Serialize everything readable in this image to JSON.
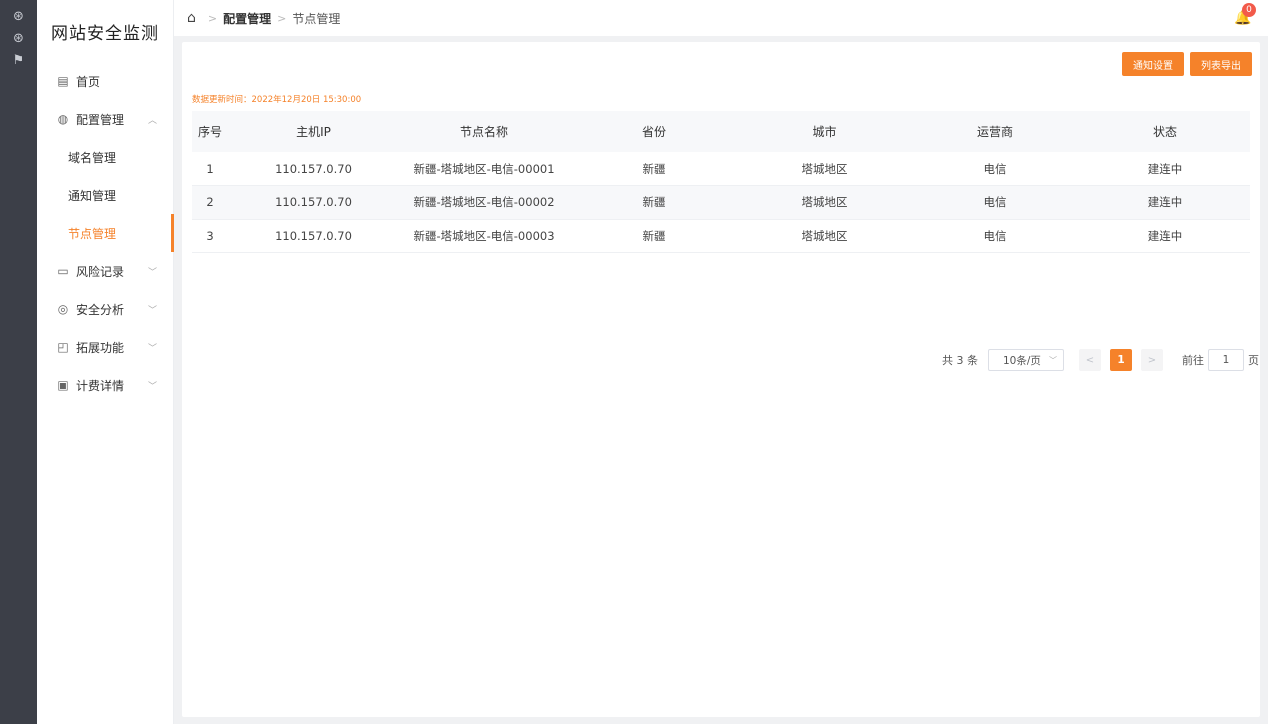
{
  "rail": {
    "icons": [
      "target-icon",
      "target-icon",
      "flag-icon"
    ]
  },
  "sidebar": {
    "title": "网站安全监测",
    "items": [
      {
        "label": "首页",
        "icon": "home-screen-icon"
      },
      {
        "label": "配置管理",
        "icon": "globe-icon",
        "expanded": true
      },
      {
        "label": "域名管理",
        "sub": true
      },
      {
        "label": "通知管理",
        "sub": true
      },
      {
        "label": "节点管理",
        "sub": true,
        "active": true
      },
      {
        "label": "风险记录",
        "icon": "monitor-alert-icon"
      },
      {
        "label": "安全分析",
        "icon": "shield-icon"
      },
      {
        "label": "拓展功能",
        "icon": "extend-icon"
      },
      {
        "label": "计费详情",
        "icon": "billing-icon"
      }
    ]
  },
  "header": {
    "breadcrumb_parent": "配置管理",
    "breadcrumb_current": "节点管理",
    "notification_count": "0"
  },
  "toolbar": {
    "notify_settings_label": "通知设置",
    "export_label": "列表导出"
  },
  "update_time": "数据更新时间：2022年12月20日 15:30:00",
  "table": {
    "columns": [
      "序号",
      "主机IP",
      "节点名称",
      "省份",
      "城市",
      "运营商",
      "状态"
    ],
    "rows": [
      [
        "1",
        "110.157.0.70",
        "新疆-塔城地区-电信-00001",
        "新疆",
        "塔城地区",
        "电信",
        "建连中"
      ],
      [
        "2",
        "110.157.0.70",
        "新疆-塔城地区-电信-00002",
        "新疆",
        "塔城地区",
        "电信",
        "建连中"
      ],
      [
        "3",
        "110.157.0.70",
        "新疆-塔城地区-电信-00003",
        "新疆",
        "塔城地区",
        "电信",
        "建连中"
      ]
    ]
  },
  "pagination": {
    "total": "共 3 条",
    "page_size": "10条/页",
    "current_page": "1",
    "goto_label": "前往",
    "goto_value": "1",
    "page_unit": "页"
  },
  "colors": {
    "accent": "#f5822a",
    "rail": "#3c3f48",
    "badge": "#f25a4a"
  }
}
